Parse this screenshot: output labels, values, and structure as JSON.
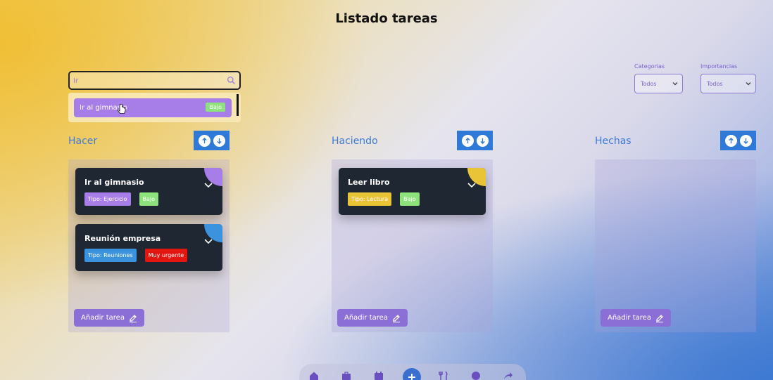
{
  "page": {
    "title": "Listado tareas"
  },
  "search": {
    "value": "Ir",
    "placeholder": ""
  },
  "suggestion": {
    "label": "Ir al gimnasio",
    "badge": "Bajo"
  },
  "filters": {
    "categories": {
      "label": "Categorias",
      "selected": "Todos"
    },
    "importance": {
      "label": "Importancias",
      "selected": "Todos"
    }
  },
  "columns": [
    {
      "title": "Hacer",
      "add_label": "Añadir tarea",
      "cards": [
        {
          "title": "Ir al gimnasio",
          "type_tag": "Tipo: Ejercicio",
          "type_color": "#a77ee7",
          "priority": "Bajo",
          "priority_color": "#8ee27b"
        },
        {
          "title": "Reunión empresa",
          "type_tag": "Tipo: Reuniones",
          "type_color": "#3c93dd",
          "priority": "Muy urgente",
          "priority_color": "#e3150f"
        }
      ]
    },
    {
      "title": "Haciendo",
      "add_label": "Añadir tarea",
      "cards": [
        {
          "title": "Leer libro",
          "type_tag": "Tipo: Lectura",
          "type_color": "#eac437",
          "priority": "Bajo",
          "priority_color": "#8ee27b"
        }
      ]
    },
    {
      "title": "Hechas",
      "add_label": "Añadir tarea",
      "cards": []
    }
  ],
  "icons": {
    "search": "search-icon",
    "sort_up": "arrow-up-icon",
    "sort_down": "arrow-down-icon",
    "expand": "chevron-down-icon",
    "add_task": "edit-icon",
    "nav": [
      "home-icon",
      "briefcase-icon",
      "calendar-icon",
      "plus-icon",
      "utensils-icon",
      "user-icon",
      "share-icon"
    ]
  },
  "colors": {
    "accent": "#3d7ad8",
    "purple": "#8b6fd6",
    "card_bg": "#1f2733"
  }
}
